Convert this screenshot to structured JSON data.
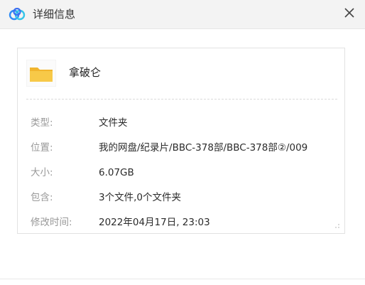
{
  "window": {
    "title": "详细信息",
    "logo_icon": "baidu-netdisk-logo",
    "close_icon": "close-icon"
  },
  "file": {
    "icon": "folder-icon",
    "name": "拿破仑"
  },
  "details": [
    {
      "label": "类型:",
      "value": "文件夹"
    },
    {
      "label": "位置:",
      "value": "我的网盘/纪录片/BBC-378部/BBC-378部②/009"
    },
    {
      "label": "大小:",
      "value": "6.07GB"
    },
    {
      "label": "包含:",
      "value": "3个文件,0个文件夹"
    },
    {
      "label": "修改时间:",
      "value": "2022年04月17日, 23:03"
    }
  ],
  "colors": {
    "folder": "#f7c948",
    "folder_tab": "#f1b52e",
    "logo_blue": "#2f8cf5",
    "logo_cyan": "#35c4e8",
    "label": "#999999"
  }
}
